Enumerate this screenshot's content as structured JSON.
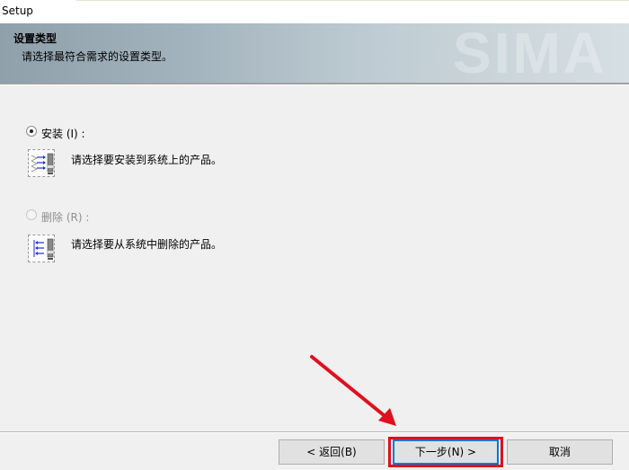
{
  "window": {
    "title": "Setup"
  },
  "banner": {
    "heading": "设置类型",
    "subtitle": "请选择最符合需求的设置类型。",
    "watermark": "SIMA"
  },
  "options": [
    {
      "label": "安装 (I) :",
      "description": "请选择要安装到系统上的产品。",
      "selected": true,
      "enabled": true,
      "icon": "install-icon"
    },
    {
      "label": "删除 (R) :",
      "description": "请选择要从系统中删除的产品。",
      "selected": false,
      "enabled": false,
      "icon": "remove-icon"
    }
  ],
  "buttons": {
    "back": "< 返回(B)",
    "next": "下一步(N) >",
    "cancel": "取消"
  },
  "annotation": {
    "color": "#e0101c"
  }
}
